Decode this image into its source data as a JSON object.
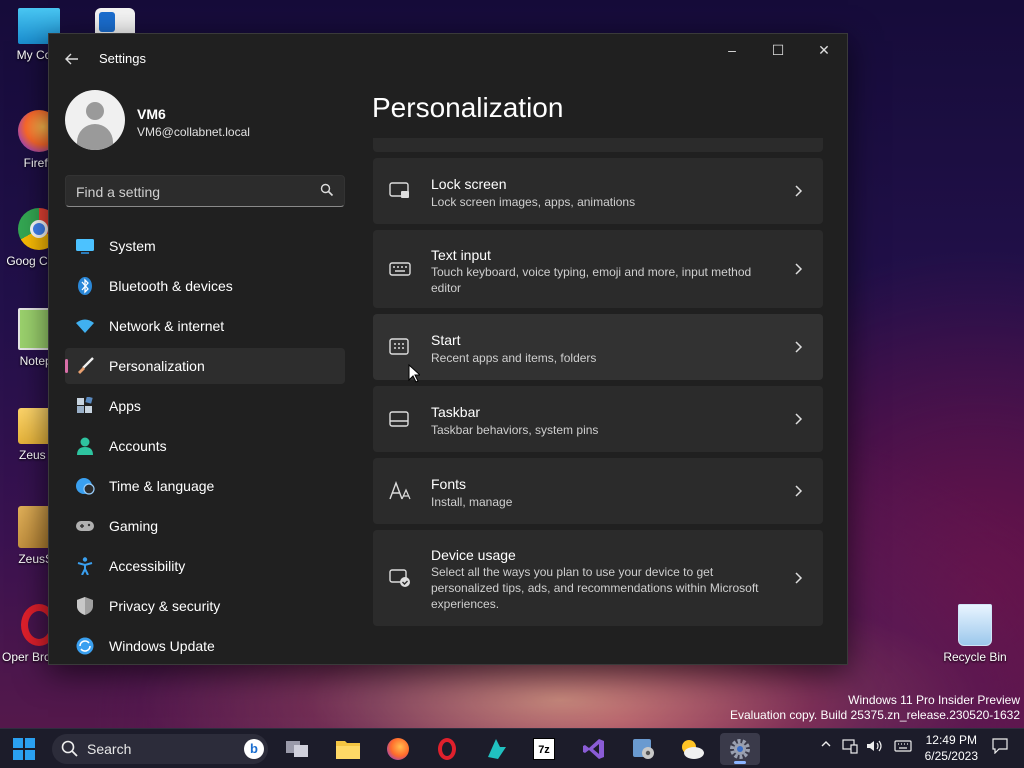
{
  "desktop": {
    "icons": [
      {
        "label": "My Com",
        "icon": "computer-icon"
      },
      {
        "label": "",
        "icon": "downloader-icon"
      },
      {
        "label": "Firefo",
        "icon": "firefox-icon"
      },
      {
        "label": "Goog Chron",
        "icon": "chrome-icon"
      },
      {
        "label": "Notepa",
        "icon": "notepad-icon"
      },
      {
        "label": "Zeus 0.",
        "icon": "folder-icon"
      },
      {
        "label": "ZeusSe",
        "icon": "package-icon"
      },
      {
        "label": "Oper Browser",
        "icon": "opera-icon"
      },
      {
        "label": "Recycle Bin",
        "icon": "recycle-bin-icon"
      }
    ],
    "watermark": {
      "line1": "Windows 11 Pro Insider Preview",
      "line2": "Evaluation copy. Build 25375.zn_release.230520-1632"
    }
  },
  "window": {
    "title": "Settings",
    "controls": {
      "minimize": "–",
      "maximize": "☐",
      "close": "✕"
    },
    "user": {
      "name": "VM6",
      "email": "VM6@collabnet.local"
    },
    "search": {
      "placeholder": "Find a setting"
    },
    "nav": [
      {
        "label": "System",
        "icon": "system-icon",
        "color": "#4cc2ff"
      },
      {
        "label": "Bluetooth & devices",
        "icon": "bluetooth-icon",
        "color": "#2b88d8"
      },
      {
        "label": "Network & internet",
        "icon": "network-icon",
        "color": "#40b0f0"
      },
      {
        "label": "Personalization",
        "icon": "brush-icon",
        "color": "#e8a070",
        "active": true
      },
      {
        "label": "Apps",
        "icon": "apps-icon",
        "color": "#9ab0c8"
      },
      {
        "label": "Accounts",
        "icon": "accounts-icon",
        "color": "#2ec4a0"
      },
      {
        "label": "Time & language",
        "icon": "globe-clock-icon",
        "color": "#3aa0f0"
      },
      {
        "label": "Gaming",
        "icon": "gamepad-icon",
        "color": "#b0b0b0"
      },
      {
        "label": "Accessibility",
        "icon": "accessibility-icon",
        "color": "#3aa0f0"
      },
      {
        "label": "Privacy & security",
        "icon": "shield-icon",
        "color": "#a0a0a0"
      },
      {
        "label": "Windows Update",
        "icon": "update-icon",
        "color": "#3aa0f0"
      }
    ],
    "page_title": "Personalization",
    "cards": [
      {
        "title": "Lock screen",
        "desc": "Lock screen images, apps, animations",
        "icon": "lock-screen-icon"
      },
      {
        "title": "Text input",
        "desc": "Touch keyboard, voice typing, emoji and more, input method editor",
        "icon": "keyboard-icon"
      },
      {
        "title": "Start",
        "desc": "Recent apps and items, folders",
        "icon": "start-menu-icon"
      },
      {
        "title": "Taskbar",
        "desc": "Taskbar behaviors, system pins",
        "icon": "taskbar-icon"
      },
      {
        "title": "Fonts",
        "desc": "Install, manage",
        "icon": "fonts-icon"
      },
      {
        "title": "Device usage",
        "desc": "Select all the ways you plan to use your device to get personalized tips, ads, and recommendations within Microsoft experiences.",
        "icon": "device-usage-icon"
      }
    ]
  },
  "taskbar": {
    "search_label": "Search",
    "apps": [
      "task-view-icon",
      "file-explorer-icon",
      "firefox-icon",
      "opera-icon",
      "app-icon",
      "7zip-icon",
      "visual-studio-icon",
      "control-panel-icon",
      "weather-icon",
      "settings-icon"
    ],
    "clock": {
      "time": "12:49 PM",
      "date": "6/25/2023"
    }
  }
}
